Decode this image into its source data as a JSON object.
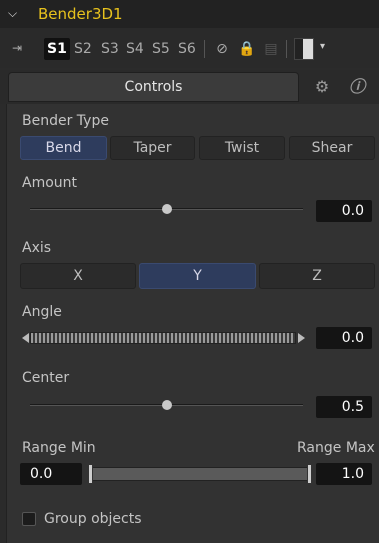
{
  "header": {
    "title": "Bender3D1"
  },
  "toolbar": {
    "slots": [
      "S1",
      "S2",
      "S3",
      "S4",
      "S5",
      "S6"
    ],
    "active_slot": "S1"
  },
  "tabs": {
    "controls_label": "Controls"
  },
  "bender_type": {
    "label": "Bender Type",
    "options": [
      "Bend",
      "Taper",
      "Twist",
      "Shear"
    ],
    "selected": "Bend"
  },
  "amount": {
    "label": "Amount",
    "value": "0.0",
    "slider_fraction": 0.5
  },
  "axis": {
    "label": "Axis",
    "options": [
      "X",
      "Y",
      "Z"
    ],
    "selected": "Y"
  },
  "angle": {
    "label": "Angle",
    "value": "0.0"
  },
  "center": {
    "label": "Center",
    "value": "0.5",
    "slider_fraction": 0.5
  },
  "range": {
    "min_label": "Range Min",
    "max_label": "Range Max",
    "min_value": "0.0",
    "max_value": "1.0"
  },
  "group_objects": {
    "label": "Group objects",
    "checked": false
  }
}
